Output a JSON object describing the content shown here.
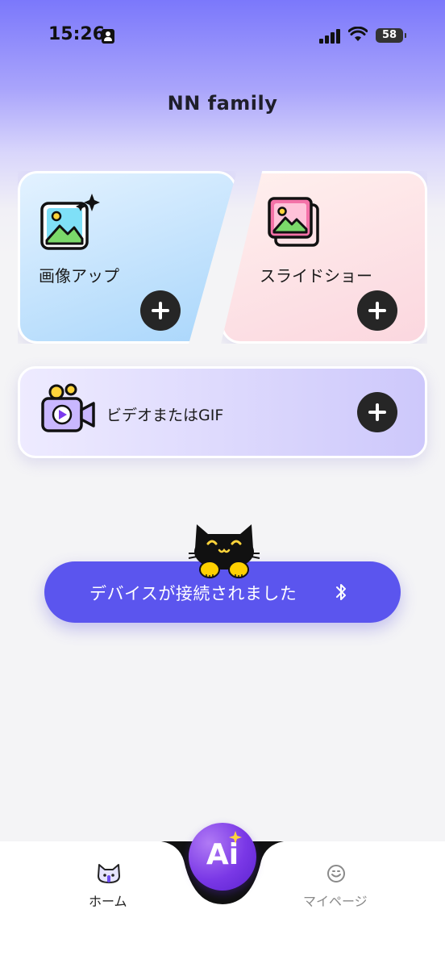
{
  "status_bar": {
    "time": "15:26",
    "battery": "58"
  },
  "header": {
    "title": "NN family"
  },
  "cards": {
    "photo": {
      "label": "画像アップ",
      "icon": "image-sparkle-icon"
    },
    "slideshow": {
      "label": "スライドショー",
      "icon": "image-stack-icon"
    },
    "video": {
      "label": "ビデオまたはGIF",
      "icon": "video-camera-icon"
    }
  },
  "device": {
    "status_label": "デバイスが接続されました",
    "icon": "bluetooth-icon"
  },
  "tabbar": {
    "home_label": "ホーム",
    "ai_label": "Ai",
    "mypage_label": "マイページ"
  },
  "colors": {
    "accent": "#5b55ee",
    "ai_button": "#7a38e6",
    "plus_button": "#262626"
  }
}
